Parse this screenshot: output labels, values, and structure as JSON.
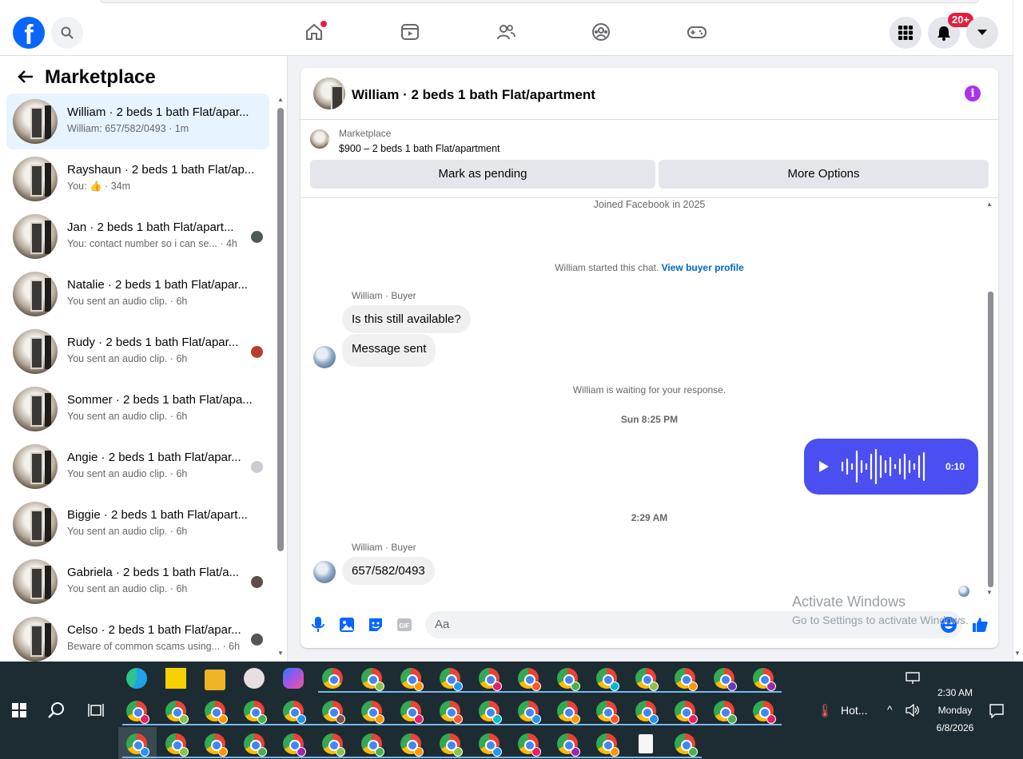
{
  "nav": {
    "logo": "f",
    "notifications_badge": "20+"
  },
  "sidebar": {
    "title": "Marketplace",
    "conversations": [
      {
        "title": "William · 2 beds 1 bath Flat/apar...",
        "subtitle": "William: 657/582/0493 · 1m"
      },
      {
        "title": "Rayshaun · 2 beds 1 bath Flat/ap...",
        "subtitle": "You: 👍 · 34m"
      },
      {
        "title": "Jan · 2 beds 1 bath Flat/apart...",
        "subtitle": "You: contact number so i can se...  · 4h"
      },
      {
        "title": "Natalie · 2 beds 1 bath Flat/apar...",
        "subtitle": "You sent an audio clip. · 6h"
      },
      {
        "title": "Rudy · 2 beds 1 bath Flat/apar...",
        "subtitle": "You sent an audio clip. · 6h"
      },
      {
        "title": "Sommer · 2 beds 1 bath Flat/apa...",
        "subtitle": "You sent an audio clip. · 6h"
      },
      {
        "title": "Angie · 2 beds 1 bath Flat/apar...",
        "subtitle": "You sent an audio clip. · 6h"
      },
      {
        "title": "Biggie · 2 beds 1 bath Flat/apart...",
        "subtitle": "You sent an audio clip. · 6h"
      },
      {
        "title": "Gabriela · 2 beds 1 bath Flat/a...",
        "subtitle": "You sent an audio clip. · 6h"
      },
      {
        "title": "Celso · 2 beds 1 bath Flat/apar...",
        "subtitle": "Beware of common scams using... · 6h"
      }
    ]
  },
  "chat": {
    "title": "William · 2 beds 1 bath Flat/apartment",
    "listing_label": "Marketplace",
    "listing_price": "$900 – 2 beds 1 bath Flat/apartment",
    "mark_pending": "Mark as pending",
    "more_options": "More Options",
    "joined": "Joined Facebook in 2025",
    "started_text": "William started this chat. ",
    "view_profile": "View buyer profile",
    "sender_label": "William · Buyer",
    "msg1": "Is this still available?",
    "msg2": "Message sent",
    "waiting": "William is waiting for your response.",
    "time1": "Sun 8:25 PM",
    "audio_duration": "0:10",
    "time2": "2:29 AM",
    "sender_label2": "William · Buyer",
    "msg3": "657/582/0493",
    "input_placeholder": "Aa"
  },
  "watermark": {
    "line1": "Activate Windows",
    "line2": "Go to Settings to activate Windows."
  },
  "taskbar": {
    "weather": "Hot...",
    "time": "2:30 AM",
    "day": "Monday",
    "date": "6/8/2026"
  },
  "colors": {
    "brand": "#0866ff",
    "audio_bubble": "#4b4ef0",
    "active_conv": "#e7f3ff"
  }
}
